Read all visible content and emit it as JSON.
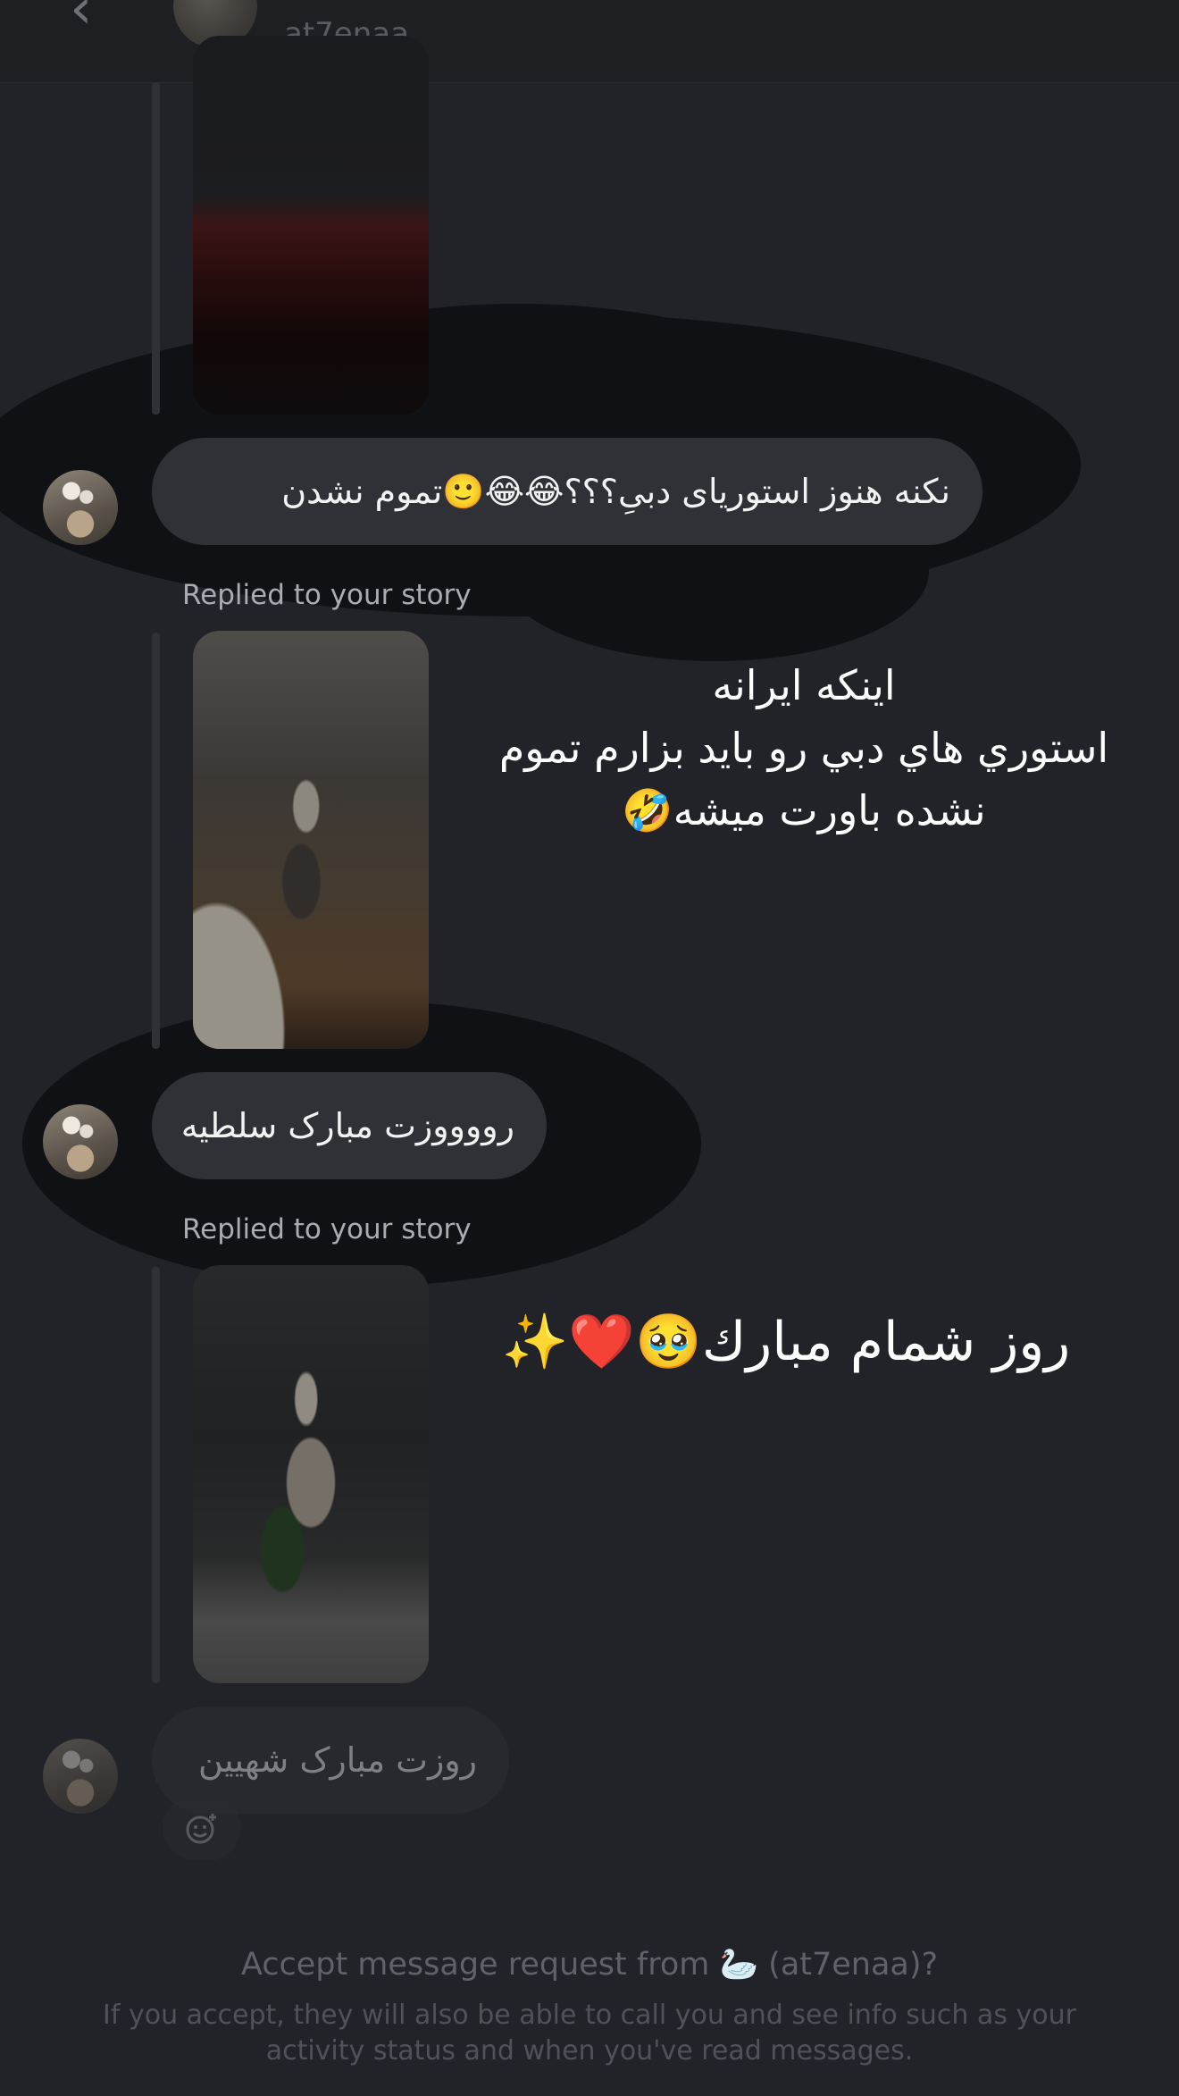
{
  "header": {
    "back_icon": "chevron-left-icon",
    "username": "at7enaa"
  },
  "messages": [
    {
      "reply_label": "",
      "text": "نکنه هنوز استوریای دبیِ؟؟؟😂😂🙂تموم نشدن"
    },
    {
      "reply_label": "Replied to your story",
      "story_caption": "اینکه ایرانه\nاستوري هاي دبي رو بايد بزارم تموم\nنشده باورت ميشه🤣",
      "text": "رووووزت مبارک سلطیه"
    },
    {
      "reply_label": "Replied to your story",
      "story_caption": "روز شمام مبارك🥹❤️✨",
      "text": "روزت مبارک شهیین"
    }
  ],
  "reaction_icon": "add-reaction-icon",
  "footer": {
    "title": "Accept message request from 🦢 (at7enaa)?",
    "body": "If you accept, they will also be able to call you and see info such as your activity status and when you've read messages."
  },
  "colors": {
    "background": "#212328",
    "bubble": "#2f3137",
    "secondary_text": "#a9acb2"
  }
}
